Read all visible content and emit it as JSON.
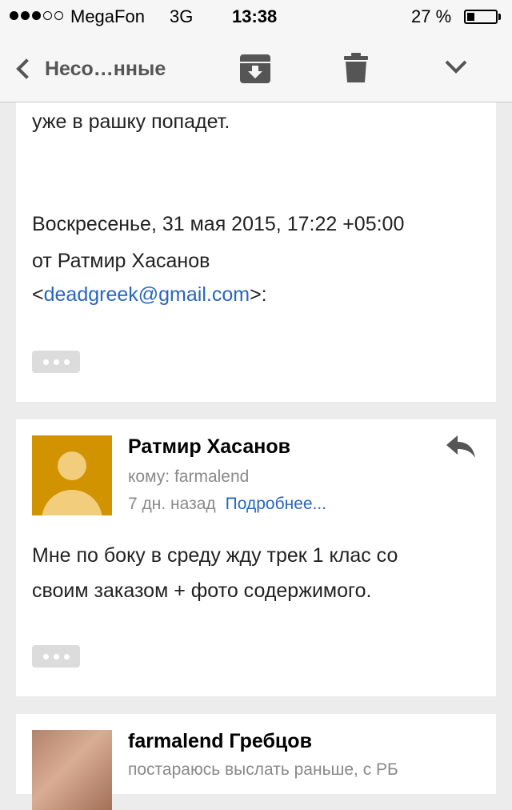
{
  "status_bar": {
    "carrier": "MegaFon",
    "network": "3G",
    "time": "13:38",
    "battery_percent_text": "27 %",
    "battery_level": 0.27
  },
  "toolbar": {
    "back_label": "Несо…нные",
    "icons": [
      "chevron-left-icon",
      "archive-icon",
      "trash-icon",
      "chevron-down-icon"
    ]
  },
  "message1": {
    "body_line": "уже в рашку попадет.",
    "quote_header_line1": "Воскресенье, 31 мая 2015, 17:22 +05:00",
    "quote_header_line2": "от Ратмир Хасанов",
    "quote_email_open": "<",
    "quote_email": "deadgreek@gmail.com",
    "quote_email_close": ">:"
  },
  "message2": {
    "sender": "Ратмир Хасанов",
    "to": "кому: farmalend",
    "time": "7 дн. назад",
    "details_link": "Подробнее...",
    "body_line1": "Мне по боку в среду жду трек 1 клас со",
    "body_line2": "своим заказом + фото содержимого."
  },
  "message3": {
    "sender": "farmalend Гребцов",
    "preview": "постараюсь выслать раньше, с РБ"
  }
}
